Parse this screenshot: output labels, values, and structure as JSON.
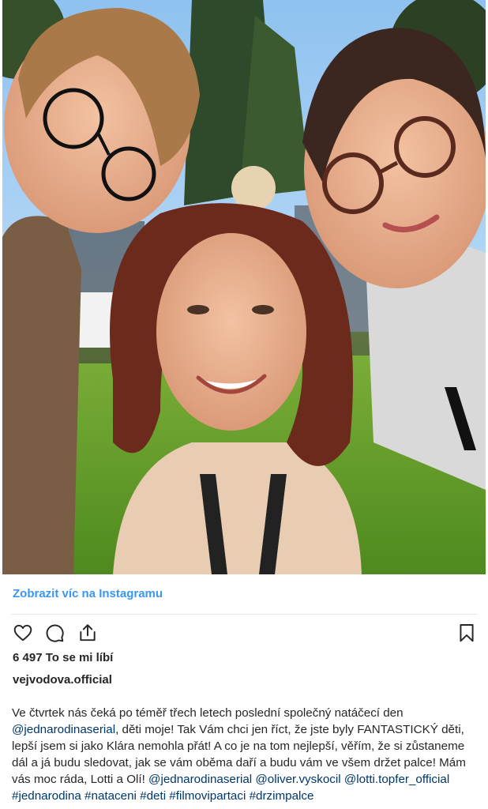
{
  "post": {
    "view_more_label": "Zobrazit víc na Instagramu",
    "likes_count": "6 497",
    "likes_label": "To se mi líbí",
    "username": "vejvodova.official",
    "caption": {
      "part1": "Ve čtvrtek nás čeká po téměř třech letech poslední společný natáčecí den ",
      "mention1": "@jednarodinaserial",
      "part2": ", děti moje! Tak Vám chci jen říct, že jste byly FANTASTICKÝ děti, lepší jsem si jako Klára nemohla přát! A co je na tom nejlepší, věřím, že si zůstaneme dál a já budu sledovat, jak se vám oběma daří a budu vám ve všem držet palce! Mám vás moc ráda, Lotti a Olí! ",
      "mention2": "@jednarodinaserial",
      "mention3": "@oliver.vyskocil",
      "mention4": "@lotti.topfer_official",
      "hashtags": "#jednarodina #nataceni #deti #filmovipartaci #drzimpalce"
    }
  },
  "icons": {
    "like": "heart-icon",
    "comment": "comment-icon",
    "share": "share-icon",
    "save": "bookmark-icon"
  },
  "colors": {
    "link_blue": "#3897f0",
    "mention_blue": "#00376b",
    "text": "#262626"
  }
}
